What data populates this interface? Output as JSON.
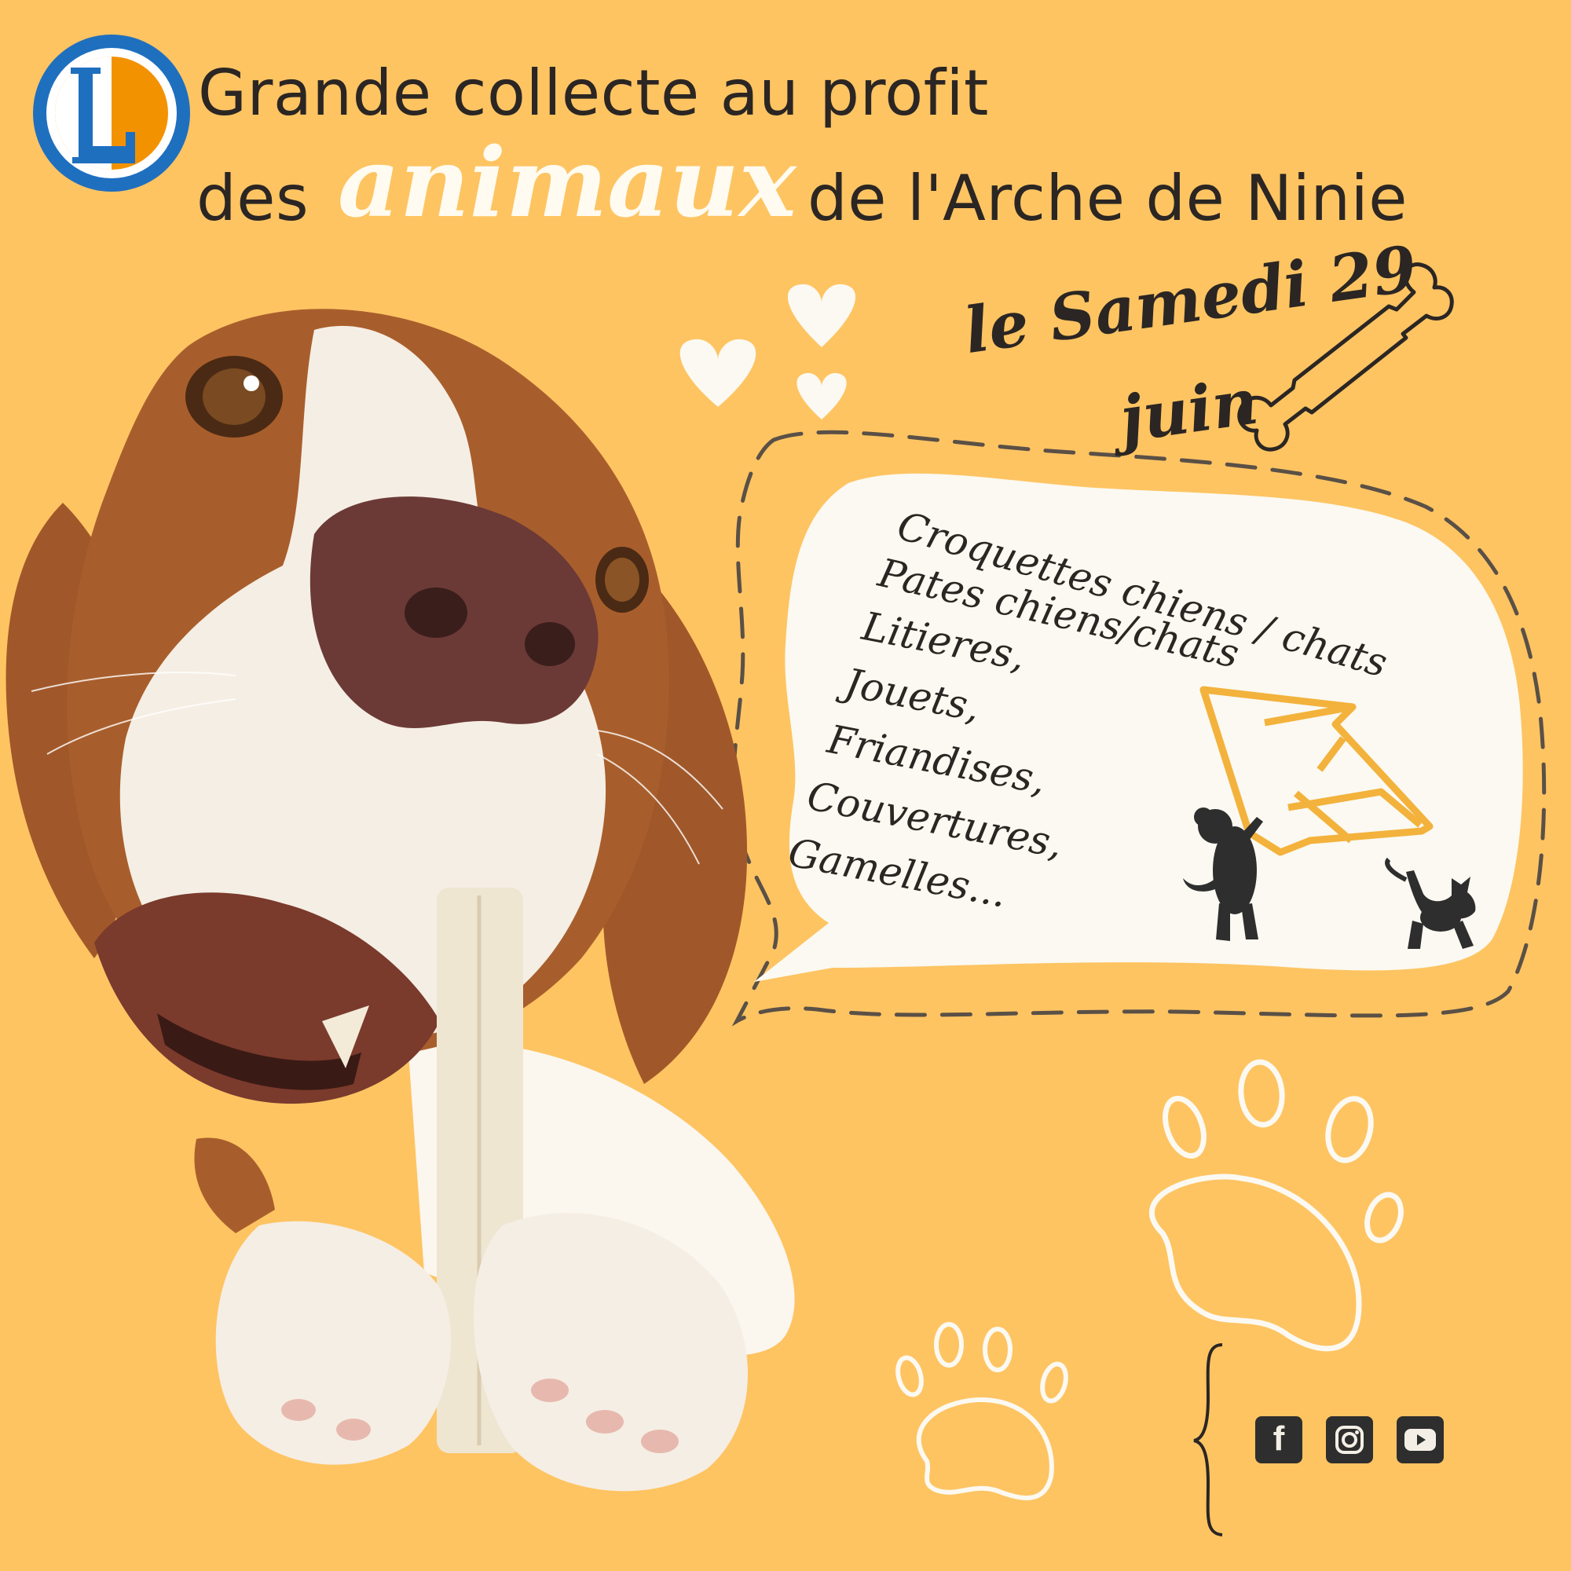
{
  "header": {
    "line1": "Grande collecte au profit",
    "line2_before": "des",
    "line2_highlight": "animaux",
    "line2_after": "de l'Arche de Ninie"
  },
  "date": {
    "line1": "le Samedi 29",
    "line2": "juin"
  },
  "items": [
    "Croquettes chiens / chats",
    "Pates chiens/chats",
    "Litieres,",
    "Jouets,",
    "Friandises,",
    "Couvertures,",
    "Gamelles..."
  ],
  "logo": {
    "letter": "L",
    "brand_colors": [
      "#1F6FBF",
      "#F39200"
    ]
  },
  "social": {
    "icons": [
      "facebook-icon",
      "instagram-icon",
      "youtube-icon"
    ],
    "letter_f": "f"
  },
  "colors": {
    "background": "#FEC462",
    "bubble": "#FBF9F1",
    "text": "#2B2623",
    "boat": "#F3B23C",
    "dog_brown": "#A0582A"
  }
}
